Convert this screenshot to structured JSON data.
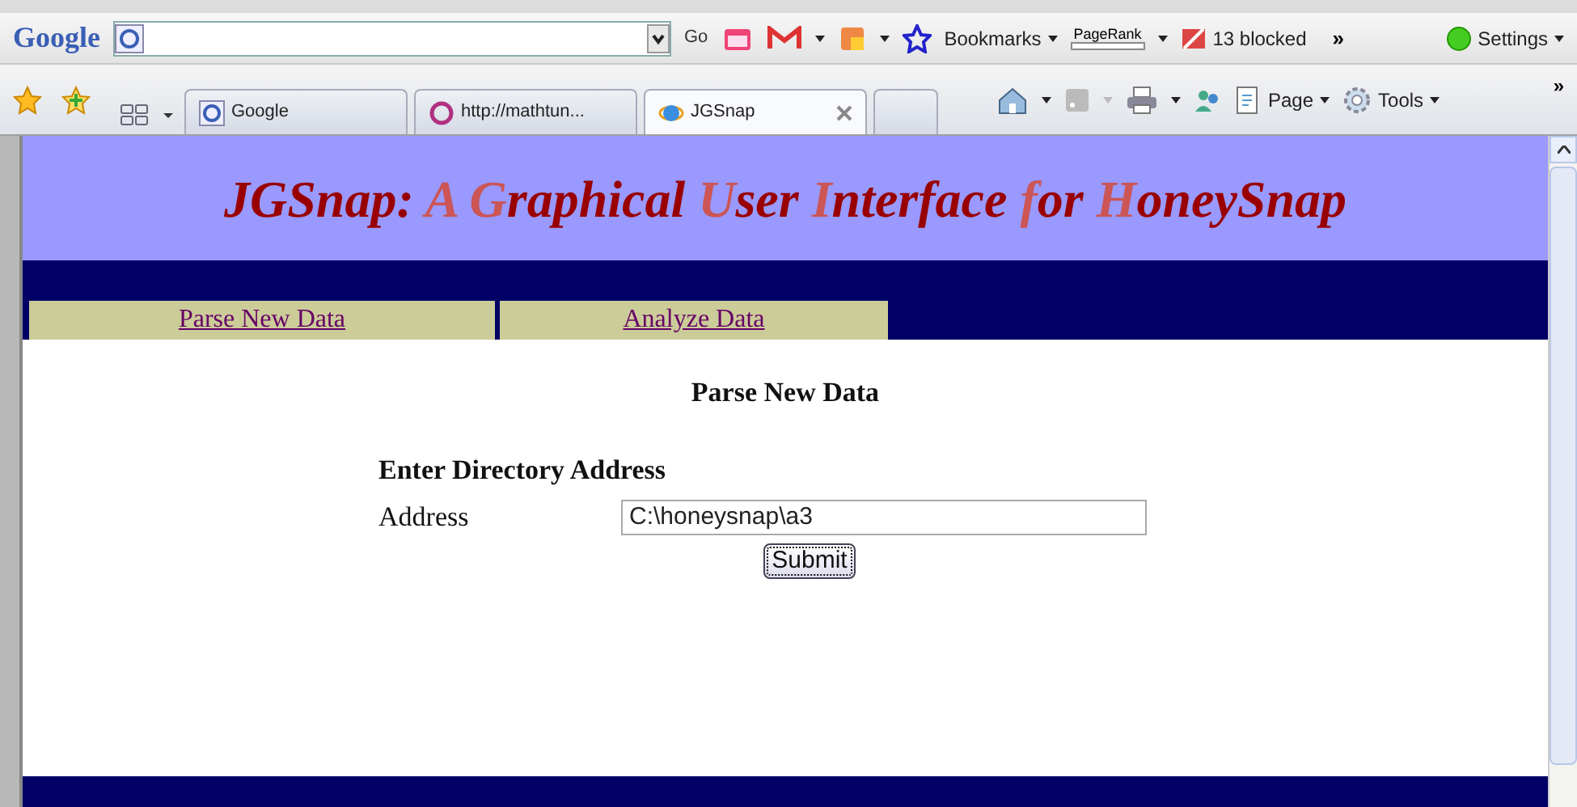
{
  "google_toolbar": {
    "logo": "Google",
    "search_go": "Go",
    "bookmarks": "Bookmarks",
    "pagerank": "PageRank",
    "blocked": "13 blocked",
    "more": "»",
    "settings": "Settings"
  },
  "tabs": [
    {
      "label": "Google",
      "selected": false
    },
    {
      "label": "http://mathtun...",
      "selected": false
    },
    {
      "label": "JGSnap",
      "selected": true
    },
    {
      "selected": false
    }
  ],
  "command_bar": {
    "page": "Page",
    "tools": "Tools",
    "more": "»"
  },
  "page": {
    "title": [
      {
        "text": "JGSnap: ",
        "accent": false
      },
      {
        "text": "A ",
        "accent": true
      },
      {
        "text": "G",
        "accent": true
      },
      {
        "text": "raphical ",
        "accent": false
      },
      {
        "text": "U",
        "accent": true
      },
      {
        "text": "ser ",
        "accent": false
      },
      {
        "text": "I",
        "accent": true
      },
      {
        "text": "nterface ",
        "accent": false
      },
      {
        "text": "f",
        "accent": true
      },
      {
        "text": "or ",
        "accent": false
      },
      {
        "text": "H",
        "accent": true
      },
      {
        "text": "oneySnap",
        "accent": false
      }
    ],
    "nav": [
      "Parse New Data",
      "Analyze Data"
    ],
    "heading": "Parse New Data",
    "form_heading": "Enter Directory Address",
    "address_label": "Address",
    "address_value": "C:\\honeysnap\\a3",
    "submit": "Submit"
  }
}
